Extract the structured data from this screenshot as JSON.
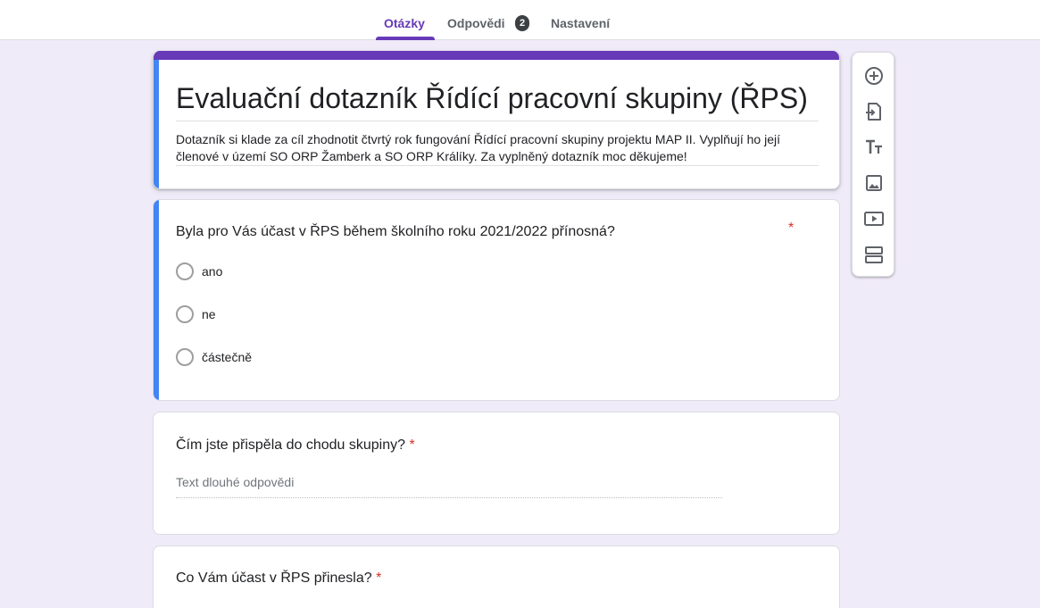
{
  "tabs": {
    "questions": "Otázky",
    "responses": "Odpovědi",
    "responses_count": "2",
    "settings": "Nastavení"
  },
  "form": {
    "title": "Evaluační dotazník Řídící pracovní skupiny (ŘPS)",
    "description": "Dotazník si klade za cíl zhodnotit čtvrtý rok fungování Řídící pracovní skupiny projektu MAP II. Vyplňují ho její členové v území SO ORP Žamberk a SO ORP Králíky. Za vyplněný dotazník moc děkujeme!"
  },
  "questions": [
    {
      "text": "Byla pro Vás účast v ŘPS během školního roku 2021/2022 přínosná?",
      "required_mark": "*",
      "options": [
        "ano",
        "ne",
        "částečně"
      ]
    },
    {
      "text": "Čím jste přispěla do chodu skupiny?",
      "required_mark": "*",
      "placeholder": "Text dlouhé odpovědi"
    },
    {
      "text": "Co Vám účast v ŘPS přinesla?",
      "required_mark": "*"
    }
  ],
  "sidebar": {
    "icons": [
      "add-question-icon",
      "import-questions-icon",
      "add-title-icon",
      "add-image-icon",
      "add-video-icon",
      "add-section-icon"
    ]
  },
  "colors": {
    "accent": "#673ab7",
    "focus": "#4285f4",
    "required": "#d93025",
    "background": "#f0ebf8"
  }
}
